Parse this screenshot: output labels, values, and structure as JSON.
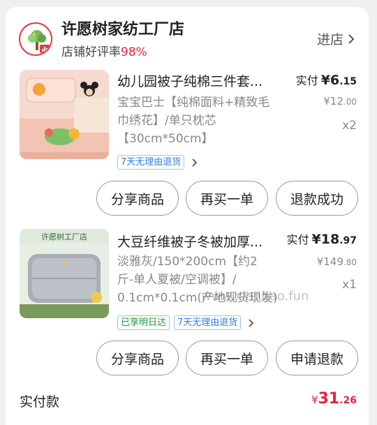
{
  "shop": {
    "logo_icon": "tree-logo-icon",
    "logo_text": "许愿",
    "name": "许愿树家纺工厂店",
    "rating_label": "店铺好评率",
    "rating_value": "98%",
    "enter_label": "进店"
  },
  "products": [
    {
      "title": "幼儿园被子纯棉三件套...",
      "paid_label": "实付",
      "paid_int": "¥6",
      "paid_dec": ".15",
      "sku_lines": [
        "宝宝巴士【纯棉面料+精致毛",
        "巾绣花】/单只枕芯",
        "【30cm*50cm】"
      ],
      "orig_int": "¥12",
      "orig_dec": ".00",
      "qty": "x2",
      "tags": [
        "7天无理由退货"
      ],
      "buttons": [
        "分享商品",
        "再买一单",
        "退款成功"
      ]
    },
    {
      "title": "大豆纤维被子冬被加厚...",
      "paid_label": "实付",
      "paid_int": "¥18",
      "paid_dec": ".97",
      "sku_lines": [
        "淡雅灰/150*200cm【约2",
        "斤-单人夏被/空调被】/",
        "0.1cm*0.1cm(产地现货现发)"
      ],
      "orig_int": "¥149",
      "orig_dec": ".80",
      "qty": "x1",
      "tags": [
        "已享明日达",
        "7天无理由退货"
      ],
      "buttons": [
        "分享商品",
        "再买一单",
        "申请退款"
      ],
      "thumb_text": "许愿树工厂店"
    }
  ],
  "total": {
    "label": "实付款",
    "currency": "¥",
    "int": "31",
    "dec": ".26"
  },
  "watermark": "www.xianbao.fun",
  "colors": {
    "accent_red": "#e8233d",
    "tag_blue": "#2a7de1",
    "tag_green": "#1f9a3a"
  }
}
